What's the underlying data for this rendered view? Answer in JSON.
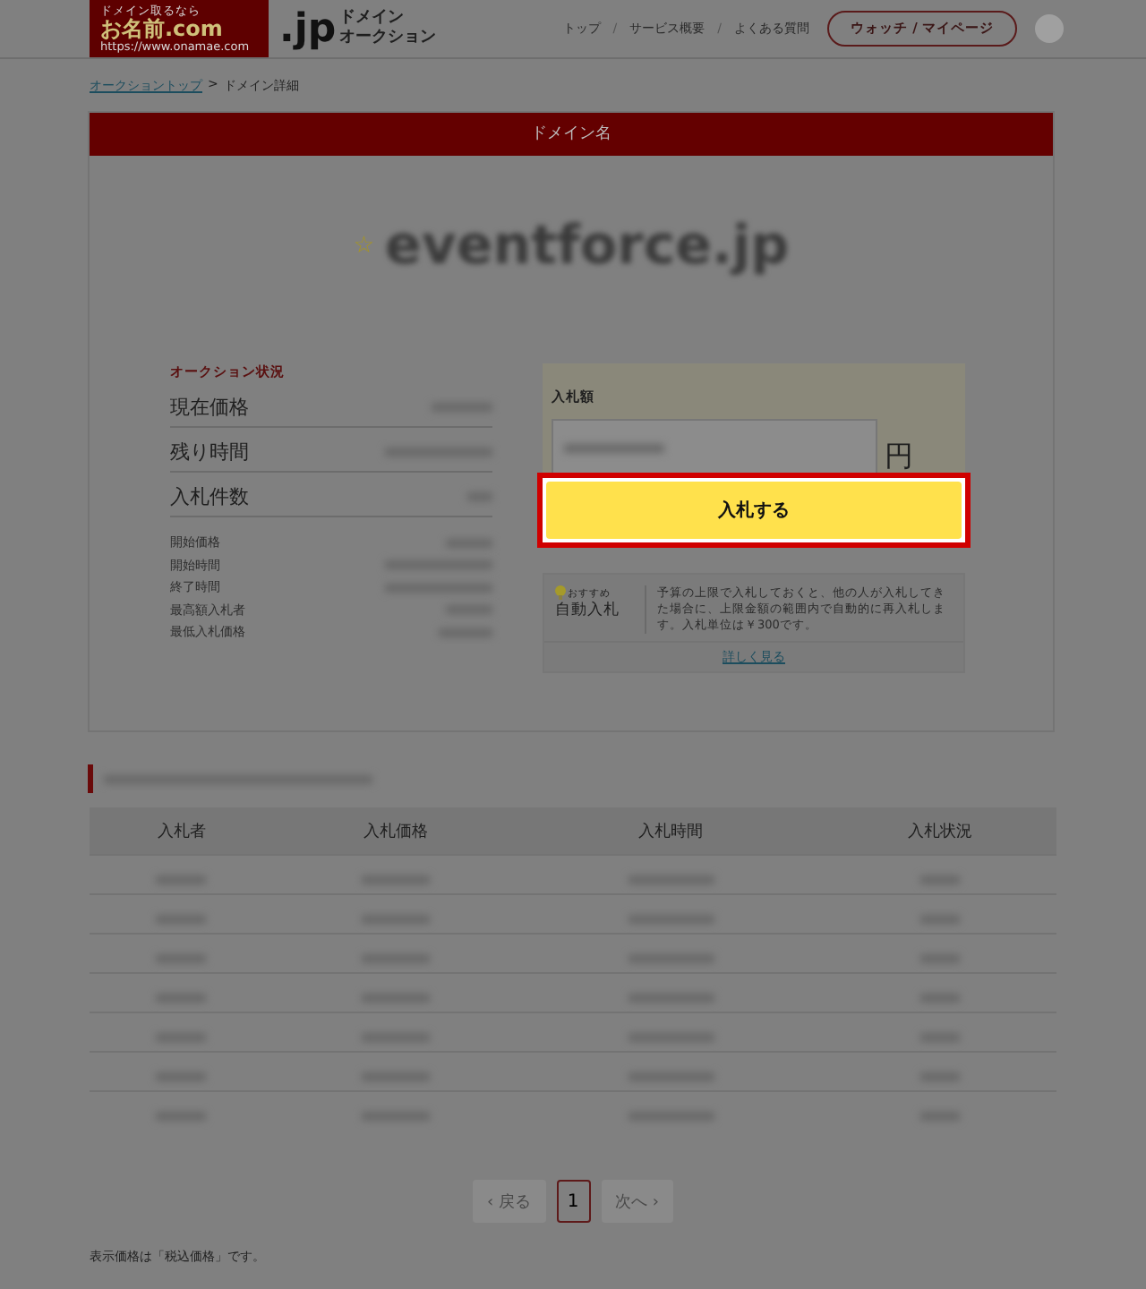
{
  "header": {
    "logo": {
      "tagline": "ドメイン取るなら",
      "name": "お名前.com",
      "url": "https://www.onamae.com"
    },
    "brand": {
      "mark": ".jp",
      "line1": "ドメイン",
      "line2": "オークション"
    },
    "nav": [
      {
        "label": "トップ"
      },
      {
        "label": "サービス概要"
      },
      {
        "label": "よくある質問"
      }
    ],
    "separator": "/",
    "account_button": {
      "left": "ウォッチ",
      "sep": "/",
      "right": "マイページ"
    }
  },
  "breadcrumb": {
    "link": "オークショントップ",
    "arrow": ">",
    "current": "ドメイン詳細"
  },
  "domain_card": {
    "title": "ドメイン名",
    "star": "☆",
    "domain": "eventforce.jp",
    "status": {
      "title": "オークション状況",
      "main_rows": [
        {
          "label": "現在価格"
        },
        {
          "label": "残り時間"
        },
        {
          "label": "入札件数"
        }
      ],
      "detail_rows": [
        {
          "label": "開始価格"
        },
        {
          "label": "開始時間"
        },
        {
          "label": "終了時間"
        },
        {
          "label": "最高額入札者"
        },
        {
          "label": "最低入札価格"
        }
      ]
    },
    "bid": {
      "label": "入札額",
      "unit": "円",
      "button": "入札する",
      "highlighted": true,
      "auto_bid": {
        "badge": "おすすめ",
        "title": "自動入札",
        "description": "予算の上限で入札しておくと、他の人が入札してきた場合に、上限金額の範囲内で自動的に再入札します。入札単位は￥300です。",
        "link": "詳しく見る"
      }
    }
  },
  "history": {
    "columns": [
      "入札者",
      "入札価格",
      "入札時間",
      "入札状況"
    ],
    "rows": [
      {
        "kind": "redacted"
      },
      {
        "kind": "redacted"
      },
      {
        "kind": "redacted"
      },
      {
        "kind": "redacted"
      },
      {
        "kind": "redacted"
      },
      {
        "kind": "redacted"
      },
      {
        "kind": "redacted"
      }
    ]
  },
  "pagination": {
    "prev": "戻る",
    "prev_icon": "‹",
    "page": "1",
    "next": "次へ",
    "next_icon": "›",
    "prev_disabled": true,
    "next_disabled": true
  },
  "note": "表示価格は「税込価格」です。"
}
